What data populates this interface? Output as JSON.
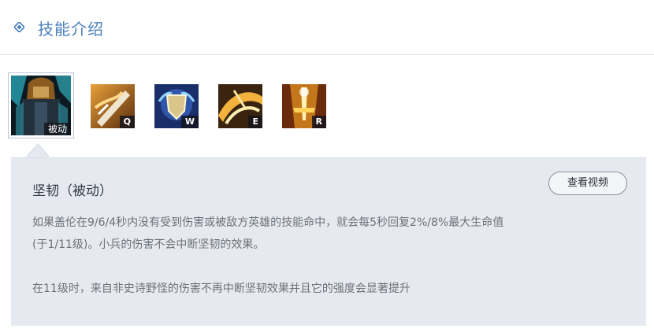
{
  "header": {
    "title": "技能介绍",
    "icon": "diamond-icon"
  },
  "skills": [
    {
      "key": "被动",
      "type": "passive",
      "icon": "passive-skill-icon"
    },
    {
      "key": "Q",
      "type": "q",
      "icon": "sword-slash-icon"
    },
    {
      "key": "W",
      "type": "w",
      "icon": "shield-crest-icon"
    },
    {
      "key": "E",
      "type": "e",
      "icon": "spin-blade-icon"
    },
    {
      "key": "R",
      "type": "r",
      "icon": "golden-sword-icon"
    }
  ],
  "detail": {
    "name": "坚韧（被动）",
    "video_label": "查看视频",
    "desc_line1": "如果盖伦在9/6/4秒内没有受到伤害或被敌方英雄的技能命中，就会每5秒回复2%/8%最大生命值",
    "desc_line2": "(于1/11级)。小兵的伤害不会中断坚韧的效果。",
    "desc_line3": "在11级时，来自非史诗野怪的伤害不再中断坚韧效果并且它的强度会显著提升"
  },
  "colors": {
    "accent": "#4a7fbe",
    "panel_bg": "#e6eaf0",
    "text": "#6d7178"
  }
}
